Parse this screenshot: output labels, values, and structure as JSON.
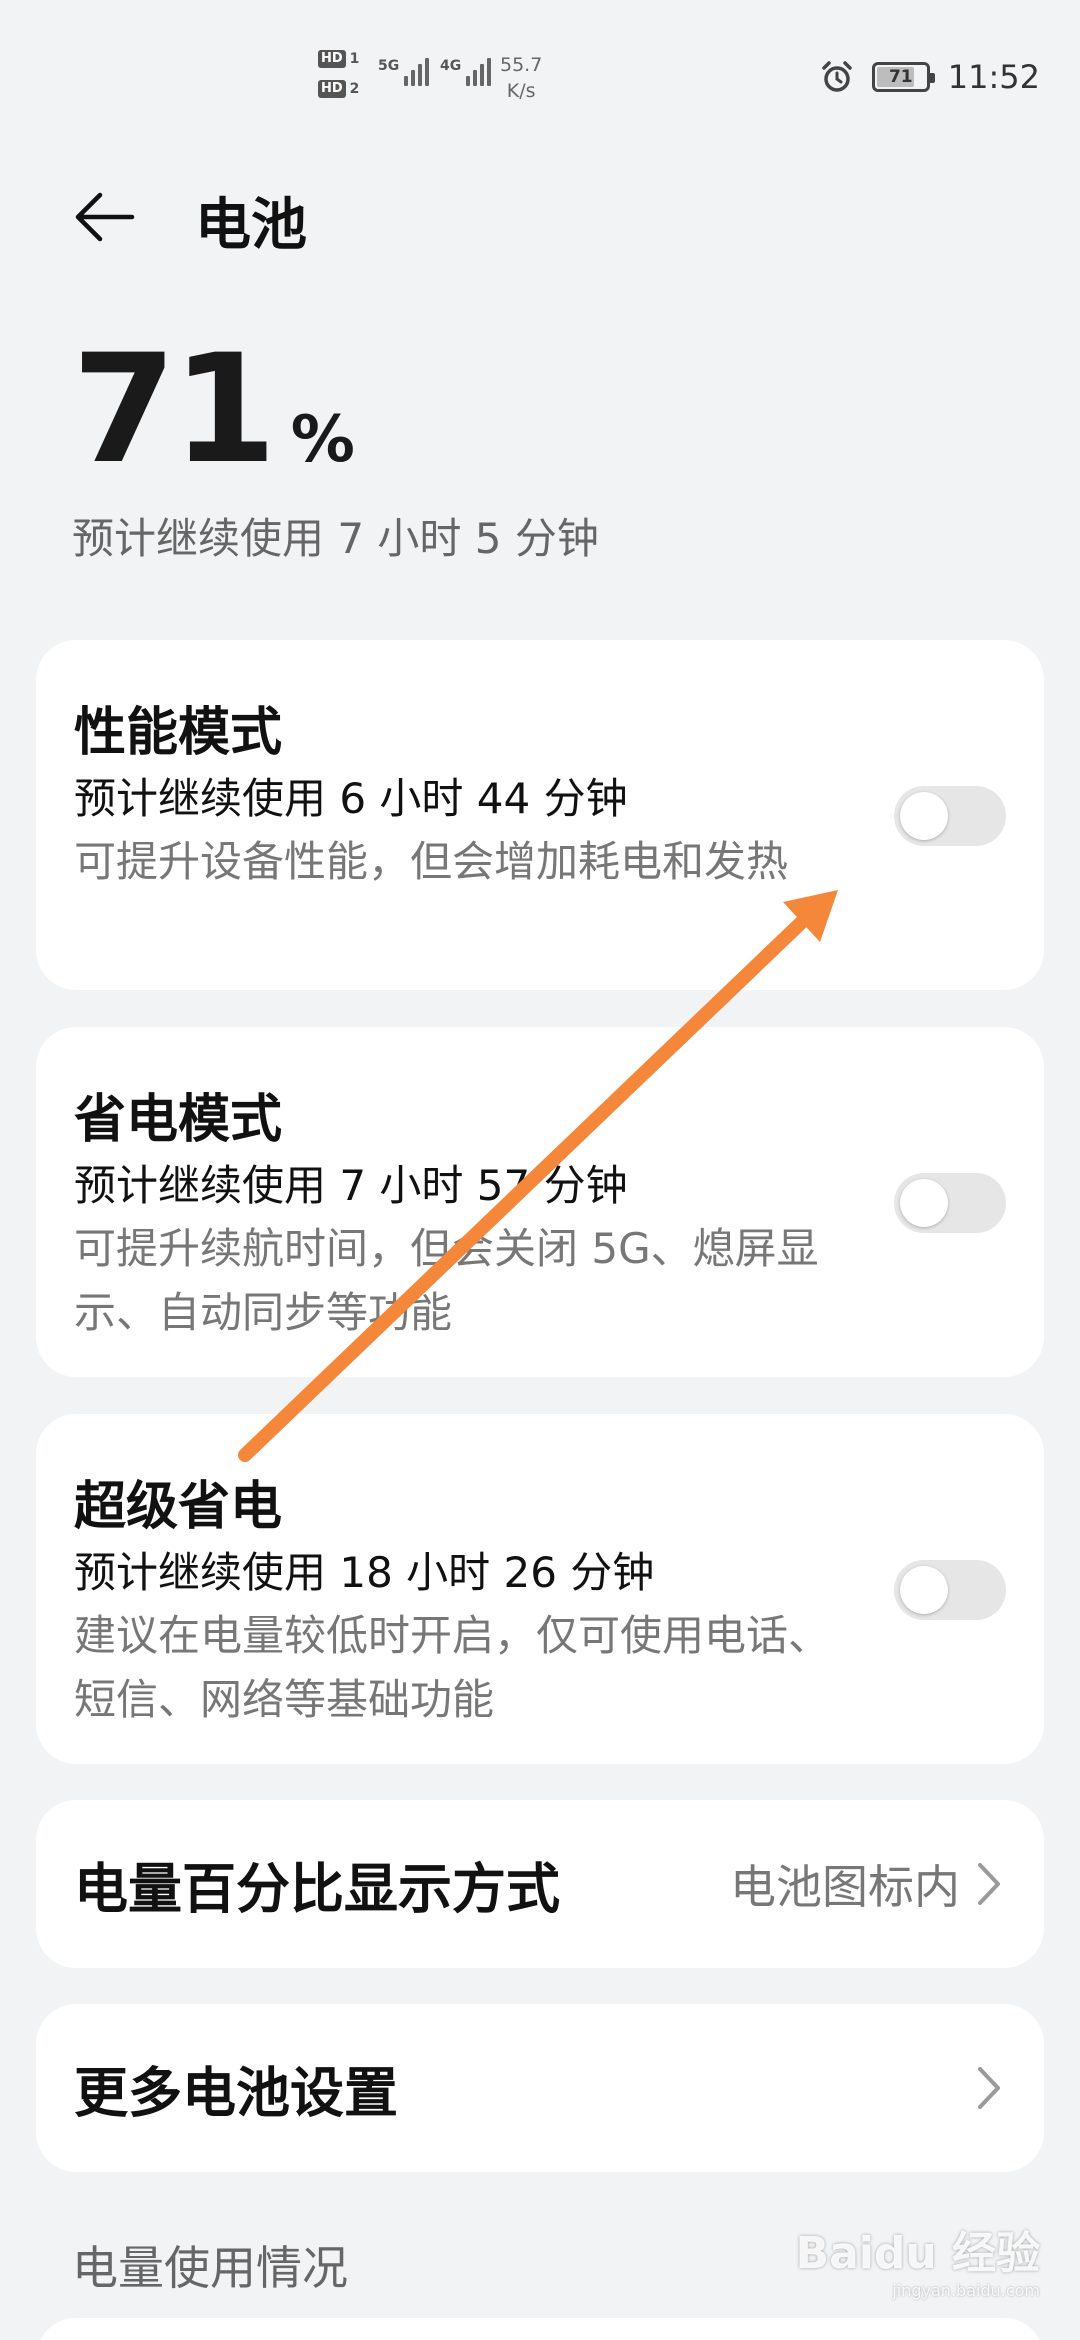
{
  "status_bar": {
    "sim1_badge": "HD",
    "sim1_num": "1",
    "sim2_badge": "HD",
    "sim2_num": "2",
    "net1": "5G",
    "net2": "4G",
    "speed_value": "55.7",
    "speed_unit": "K/s",
    "battery": "71",
    "battery_level": 0.71,
    "time": "11:52"
  },
  "header": {
    "title": "电池",
    "back_icon": "back-arrow-icon"
  },
  "battery": {
    "level": "71",
    "unit": "%",
    "estimate": "预计继续使用 7 小时 5 分钟"
  },
  "modes": [
    {
      "title": "性能模式",
      "estimate": "预计继续使用 6 小时 44 分钟",
      "description": "可提升设备性能，但会增加耗电和发热",
      "enabled": false
    },
    {
      "title": "省电模式",
      "estimate": "预计继续使用 7 小时 57 分钟",
      "description": "可提升续航时间，但会关闭 5G、熄屏显示、自动同步等功能",
      "enabled": false
    },
    {
      "title": "超级省电",
      "estimate": "预计继续使用 18 小时 26 分钟",
      "description": "建议在电量较低时开启，仅可使用电话、短信、网络等基础功能",
      "enabled": false
    }
  ],
  "percentage_display": {
    "label": "电量百分比显示方式",
    "value": "电池图标内"
  },
  "more_settings": {
    "label": "更多电池设置"
  },
  "usage_section": {
    "label": "电量使用情况"
  },
  "colors": {
    "background": "#f1f3f5",
    "card": "#ffffff",
    "toggle_off": "#e6e6e6",
    "annotation_arrow": "#f5873a"
  },
  "watermark": {
    "main": "Baidu 经验",
    "sub": "jingyan.baidu.com"
  }
}
